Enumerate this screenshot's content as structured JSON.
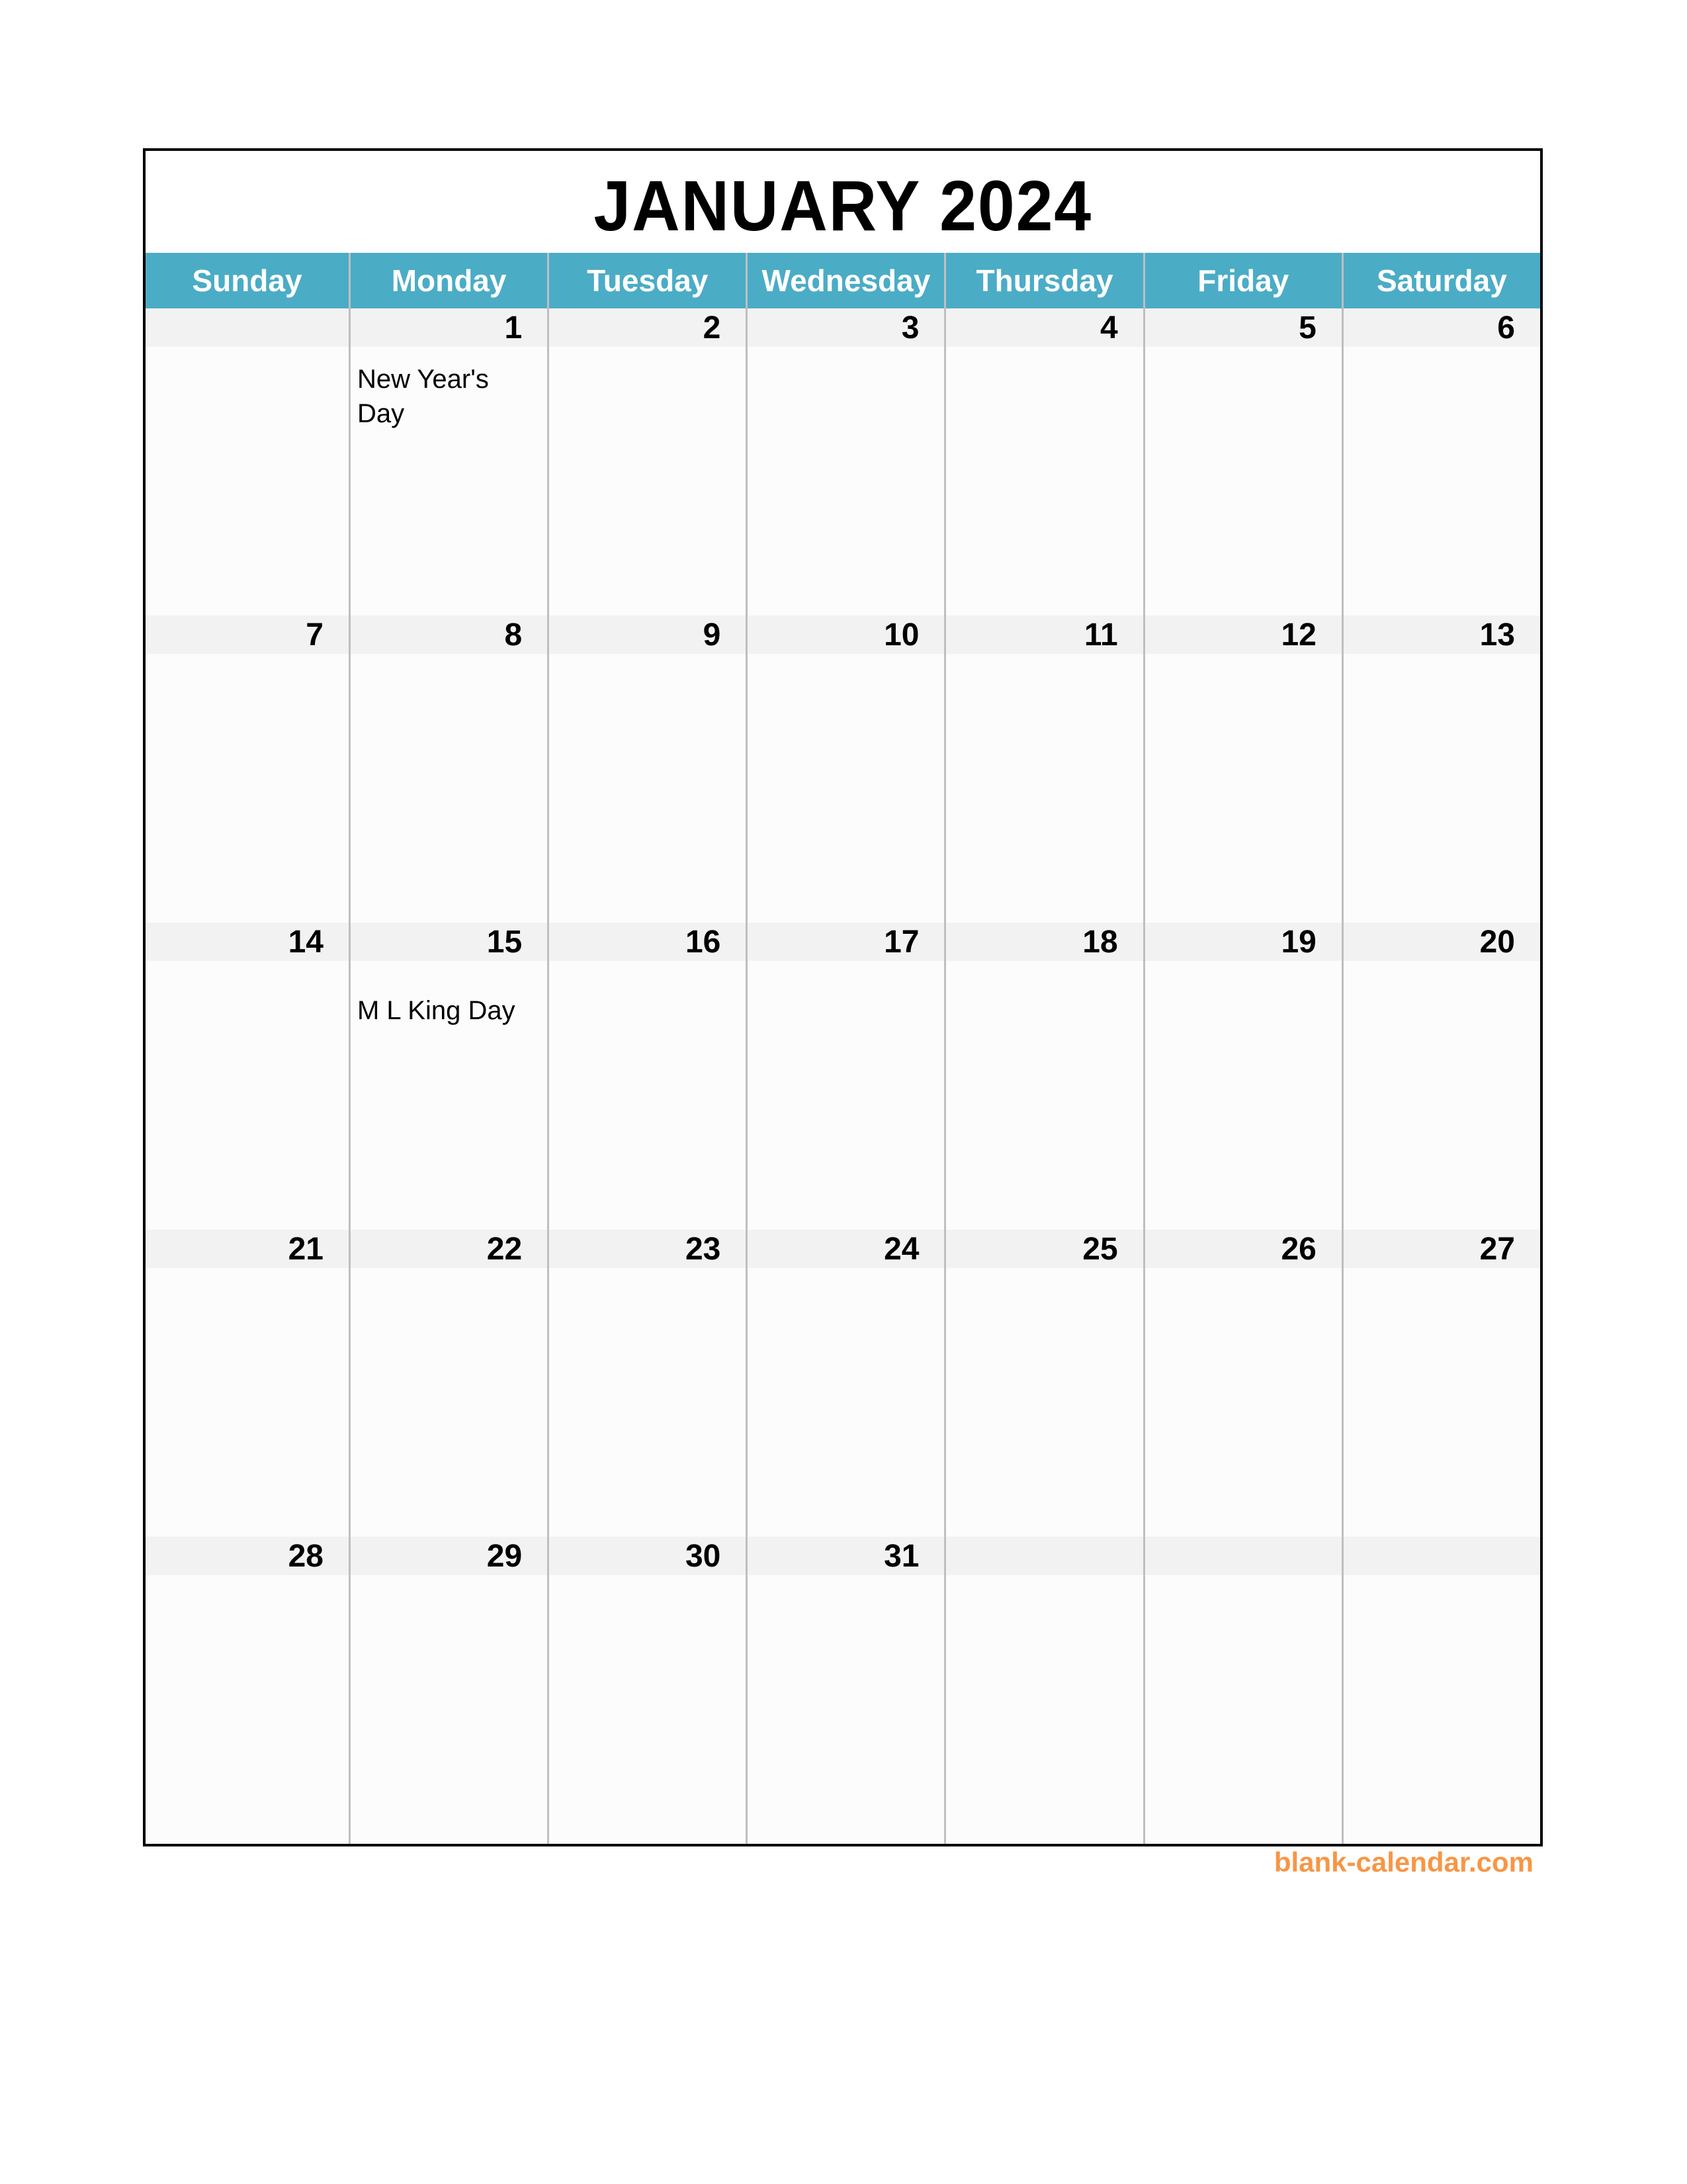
{
  "calendar": {
    "title": "JANUARY 2024",
    "header_color": "#4BACC6",
    "weekdays": [
      "Sunday",
      "Monday",
      "Tuesday",
      "Wednesday",
      "Thursday",
      "Friday",
      "Saturday"
    ],
    "weeks": [
      [
        {
          "date": "",
          "note": ""
        },
        {
          "date": "1",
          "note": "New Year's Day"
        },
        {
          "date": "2",
          "note": ""
        },
        {
          "date": "3",
          "note": ""
        },
        {
          "date": "4",
          "note": ""
        },
        {
          "date": "5",
          "note": ""
        },
        {
          "date": "6",
          "note": ""
        }
      ],
      [
        {
          "date": "7",
          "note": ""
        },
        {
          "date": "8",
          "note": ""
        },
        {
          "date": "9",
          "note": ""
        },
        {
          "date": "10",
          "note": ""
        },
        {
          "date": "11",
          "note": ""
        },
        {
          "date": "12",
          "note": ""
        },
        {
          "date": "13",
          "note": ""
        }
      ],
      [
        {
          "date": "14",
          "note": ""
        },
        {
          "date": "15",
          "note": "M L King Day"
        },
        {
          "date": "16",
          "note": ""
        },
        {
          "date": "17",
          "note": ""
        },
        {
          "date": "18",
          "note": ""
        },
        {
          "date": "19",
          "note": ""
        },
        {
          "date": "20",
          "note": ""
        }
      ],
      [
        {
          "date": "21",
          "note": ""
        },
        {
          "date": "22",
          "note": ""
        },
        {
          "date": "23",
          "note": ""
        },
        {
          "date": "24",
          "note": ""
        },
        {
          "date": "25",
          "note": ""
        },
        {
          "date": "26",
          "note": ""
        },
        {
          "date": "27",
          "note": ""
        }
      ],
      [
        {
          "date": "28",
          "note": ""
        },
        {
          "date": "29",
          "note": ""
        },
        {
          "date": "30",
          "note": ""
        },
        {
          "date": "31",
          "note": ""
        },
        {
          "date": "",
          "note": ""
        },
        {
          "date": "",
          "note": ""
        },
        {
          "date": "",
          "note": ""
        }
      ]
    ]
  },
  "footer": {
    "site_label": "blank-calendar.com",
    "site_color": "#F79646"
  }
}
